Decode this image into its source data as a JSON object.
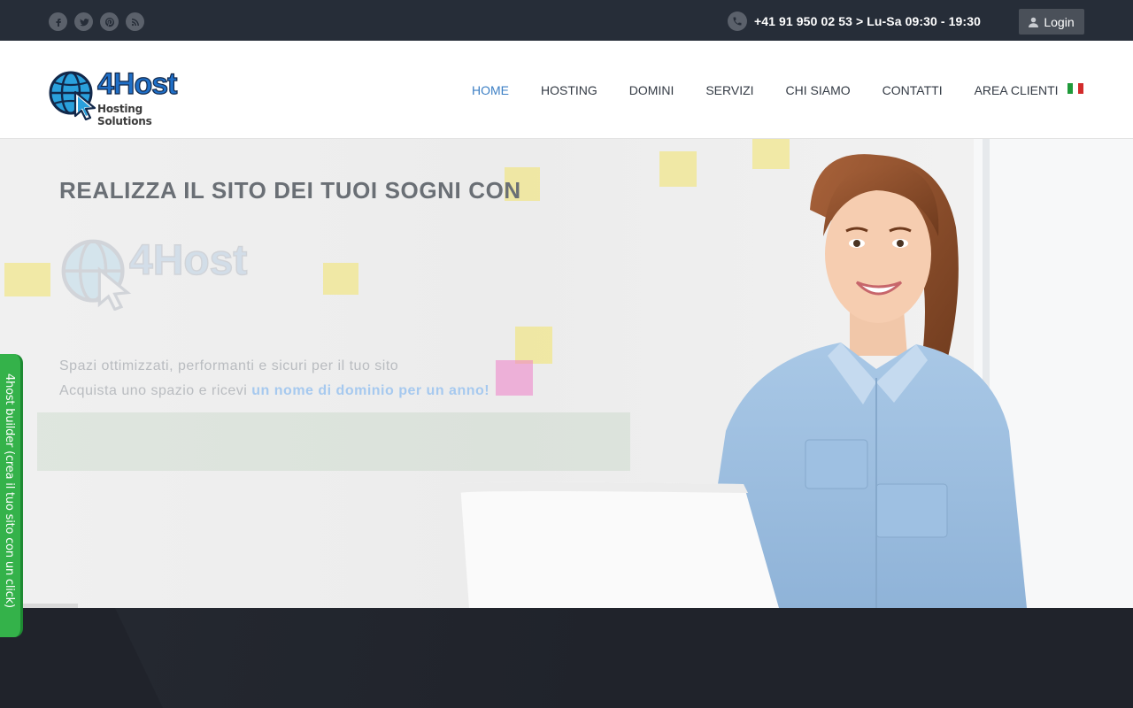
{
  "topbar": {
    "socials": [
      {
        "icon": "facebook-icon"
      },
      {
        "icon": "twitter-icon"
      },
      {
        "icon": "pinterest-icon"
      },
      {
        "icon": "rss-icon"
      }
    ],
    "phone": "+41 91 950 02 53 > Lu-Sa 09:30 - 19:30",
    "login_label": "Login"
  },
  "header": {
    "logo_word": "4Host",
    "logo_sub": "Hosting Solutions",
    "nav": [
      "HOME",
      "HOSTING",
      "DOMINI",
      "SERVIZI",
      "CHI SIAMO",
      "CONTATTI",
      "AREA CLIENTI"
    ],
    "active_nav": "HOME",
    "language_flag": "italian-flag-icon"
  },
  "hero": {
    "title": "REALIZZA IL SITO DEI TUOI SOGNI CON",
    "logo_word": "4Host",
    "subtitle_line1": "Spazi ottimizzati, performanti e sicuri per il tuo sito",
    "subtitle_line2": "Acquista uno spazio e ricevi",
    "subtitle_highlight": "un nome di dominio per un anno!"
  },
  "side_tab": {
    "label": "4host builder (crea il tuo sito con un click)"
  },
  "colors": {
    "topbar_bg": "#262d38",
    "accent": "#3c7fc4",
    "side_tab": "#34b24a",
    "dark_section": "#20232b"
  }
}
